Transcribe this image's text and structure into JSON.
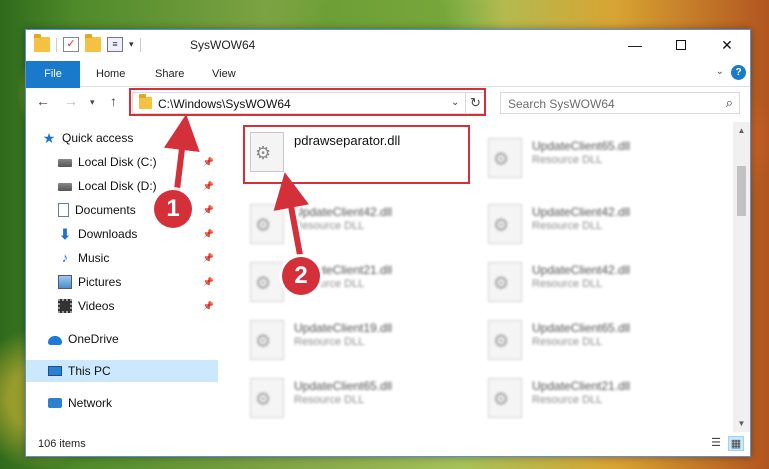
{
  "window": {
    "title": "SysWOW64",
    "minimize_glyph": "—",
    "close_glyph": "✕"
  },
  "ribbon": {
    "tabs": [
      {
        "label": "File"
      },
      {
        "label": "Home"
      },
      {
        "label": "Share"
      },
      {
        "label": "View"
      }
    ],
    "help_glyph": "?"
  },
  "address": {
    "path": "C:\\Windows\\SysWOW64",
    "search_placeholder": "Search SysWOW64"
  },
  "nav_pane": {
    "items": [
      {
        "label": "Quick access",
        "icon": "star-icon"
      },
      {
        "label": "Local Disk (C:)",
        "icon": "drive-icon",
        "pinned": true
      },
      {
        "label": "Local Disk (D:)",
        "icon": "drive-icon",
        "pinned": true
      },
      {
        "label": "Documents",
        "icon": "document-icon",
        "pinned": true
      },
      {
        "label": "Downloads",
        "icon": "download-icon",
        "pinned": true
      },
      {
        "label": "Music",
        "icon": "music-icon",
        "pinned": true
      },
      {
        "label": "Pictures",
        "icon": "pictures-icon",
        "pinned": true
      },
      {
        "label": "Videos",
        "icon": "videos-icon",
        "pinned": true
      },
      {
        "label": "OneDrive",
        "icon": "onedrive-icon"
      },
      {
        "label": "This PC",
        "icon": "this-pc-icon",
        "selected": true
      },
      {
        "label": "Network",
        "icon": "network-icon"
      }
    ]
  },
  "files": {
    "left": [
      {
        "name": "pdrawseparator.dll",
        "type": ""
      },
      {
        "name": "UpdateClient42.dll",
        "type": "Resource DLL"
      },
      {
        "name": "UpdateClient21.dll",
        "type": "Resource DLL"
      },
      {
        "name": "UpdateClient19.dll",
        "type": "Resource DLL"
      },
      {
        "name": "UpdateClient65.dll",
        "type": "Resource DLL"
      }
    ],
    "right": [
      {
        "name": "UpdateClient65.dll",
        "type": "Resource DLL"
      },
      {
        "name": "UpdateClient42.dll",
        "type": "Resource DLL"
      },
      {
        "name": "UpdateClient42.dll",
        "type": "Resource DLL"
      },
      {
        "name": "UpdateClient65.dll",
        "type": "Resource DLL"
      },
      {
        "name": "UpdateClient21.dll",
        "type": "Resource DLL"
      }
    ]
  },
  "status": {
    "item_count": "106 items"
  },
  "callouts": {
    "one": "1",
    "two": "2"
  },
  "colors": {
    "accent": "#1979ca",
    "highlight": "#d4303a",
    "selected_bg": "#cce8ff"
  }
}
